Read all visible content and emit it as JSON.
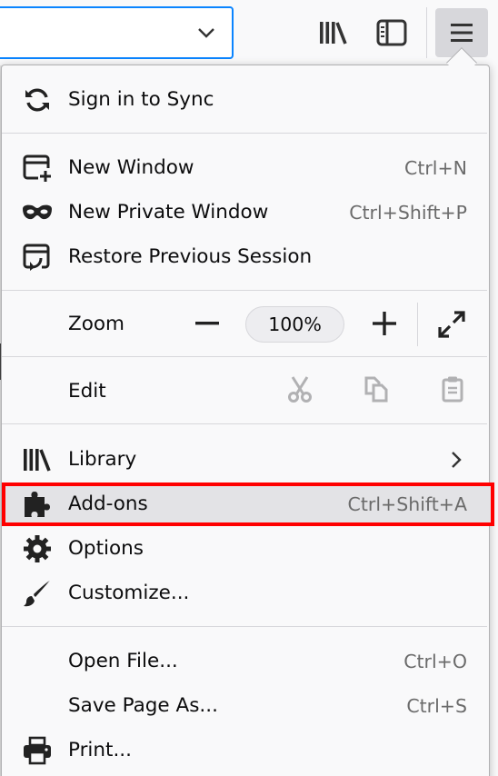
{
  "toolbar": {
    "url_dropdown_icon": "chevron-down-icon",
    "library_icon": "library-icon",
    "sidebar_icon": "sidebar-icon",
    "menu_icon": "hamburger-menu-icon"
  },
  "menu": {
    "sign_in": {
      "label": "Sign in to Sync",
      "icon": "sync-icon"
    },
    "new_window": {
      "label": "New Window",
      "shortcut": "Ctrl+N",
      "icon": "new-window-icon"
    },
    "new_private_window": {
      "label": "New Private Window",
      "shortcut": "Ctrl+Shift+P",
      "icon": "private-mask-icon"
    },
    "restore_session": {
      "label": "Restore Previous Session",
      "icon": "restore-session-icon"
    },
    "zoom": {
      "label": "Zoom",
      "level": "100%"
    },
    "edit": {
      "label": "Edit"
    },
    "library": {
      "label": "Library"
    },
    "addons": {
      "label": "Add-ons",
      "shortcut": "Ctrl+Shift+A",
      "icon": "puzzle-piece-icon"
    },
    "options": {
      "label": "Options",
      "icon": "gear-icon"
    },
    "customize": {
      "label": "Customize...",
      "icon": "paintbrush-icon"
    },
    "open_file": {
      "label": "Open File...",
      "shortcut": "Ctrl+O"
    },
    "save_page": {
      "label": "Save Page As...",
      "shortcut": "Ctrl+S"
    },
    "print": {
      "label": "Print...",
      "icon": "printer-icon"
    }
  },
  "colors": {
    "highlight": "#ff0000",
    "focus": "#0a84ff"
  }
}
